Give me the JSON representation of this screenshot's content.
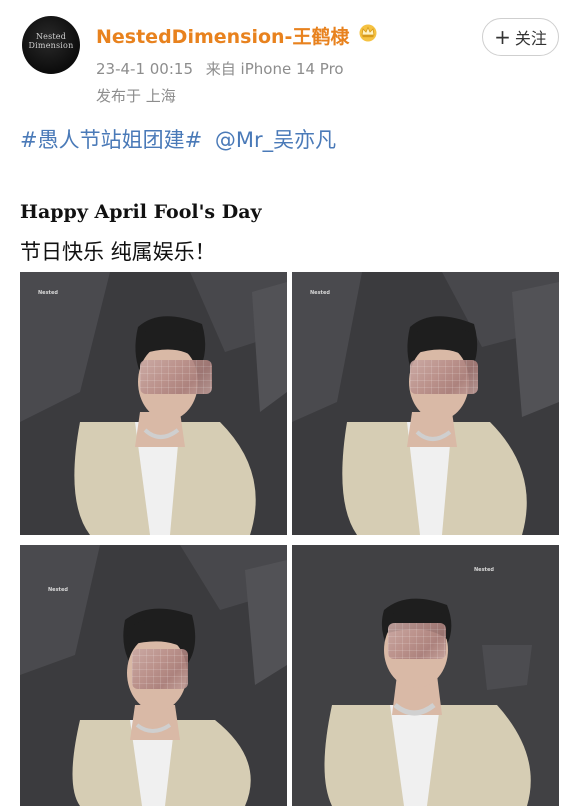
{
  "post": {
    "author": {
      "username": "NestedDimension-王鹤棣",
      "avatar_text_line1": "Nested",
      "avatar_text_line2": "Dimension",
      "verified_badge_icon": "crown-icon"
    },
    "follow_button": {
      "label": "关注",
      "icon": "plus-icon"
    },
    "meta": {
      "timestamp": "23-4-1 00:15",
      "source": "来自 iPhone 14 Pro",
      "location": "发布于 上海"
    },
    "hashtags": [
      "#愚人节站姐团建#",
      "@Mr_吴亦凡"
    ],
    "title": "Happy April Fool's Day",
    "subtitle": "节日快乐 纯属娱乐！",
    "photos": [
      {
        "brand_text": "Nested"
      },
      {
        "brand_text": "Nested"
      },
      {
        "brand_text": "Nested"
      },
      {
        "brand_text": "Nested"
      }
    ]
  },
  "colors": {
    "username": "#e8821e",
    "link": "#4a7ab8",
    "meta": "#8d8d8d",
    "photo_bg": "#3a3a3c",
    "jacket": "#d6cdb4"
  }
}
